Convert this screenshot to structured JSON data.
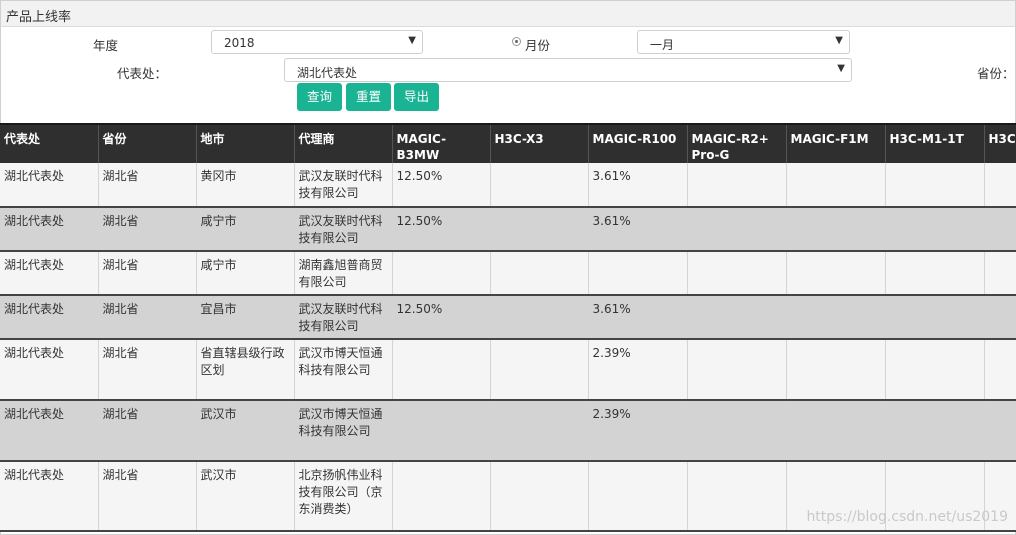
{
  "page": {
    "title": "产品上线率"
  },
  "filters": {
    "year_label": "年度",
    "year_value": "2018",
    "month_label": "月份",
    "month_value": "一月",
    "office_label": "代表处：",
    "office_value": "湖北代表处",
    "province_label": "省份："
  },
  "buttons": {
    "query": "查询",
    "reset": "重置",
    "export": "导出"
  },
  "table": {
    "columns": [
      "代表处",
      "省份",
      "地市",
      "代理商",
      "MAGIC-B3MW",
      "H3C-X3",
      "MAGIC-R100",
      "MAGIC-R2+ Pro-G",
      "MAGIC-F1M",
      "H3C-M1-1T",
      "H3C"
    ],
    "rows": [
      [
        "湖北代表处",
        "湖北省",
        "黄冈市",
        "武汉友联时代科技有限公司",
        "12.50%",
        "",
        "3.61%",
        "",
        "",
        "",
        ""
      ],
      [
        "湖北代表处",
        "湖北省",
        "咸宁市",
        "武汉友联时代科技有限公司",
        "12.50%",
        "",
        "3.61%",
        "",
        "",
        "",
        ""
      ],
      [
        "湖北代表处",
        "湖北省",
        "咸宁市",
        "湖南鑫旭普商贸有限公司",
        "",
        "",
        "",
        "",
        "",
        "",
        ""
      ],
      [
        "湖北代表处",
        "湖北省",
        "宜昌市",
        "武汉友联时代科技有限公司",
        "12.50%",
        "",
        "3.61%",
        "",
        "",
        "",
        ""
      ],
      [
        "湖北代表处",
        "湖北省",
        "省直辖县级行政区划",
        "武汉市博天恒通科技有限公司",
        "",
        "",
        "2.39%",
        "",
        "",
        "",
        ""
      ],
      [
        "湖北代表处",
        "湖北省",
        "武汉市",
        "武汉市博天恒通科技有限公司",
        "",
        "",
        "2.39%",
        "",
        "",
        "",
        ""
      ],
      [
        "湖北代表处",
        "湖北省",
        "武汉市",
        "北京扬帆伟业科技有限公司（京东消费类）",
        "",
        "",
        "",
        "",
        "",
        "",
        ""
      ]
    ]
  },
  "watermark": "https://blog.csdn.net/us2019"
}
